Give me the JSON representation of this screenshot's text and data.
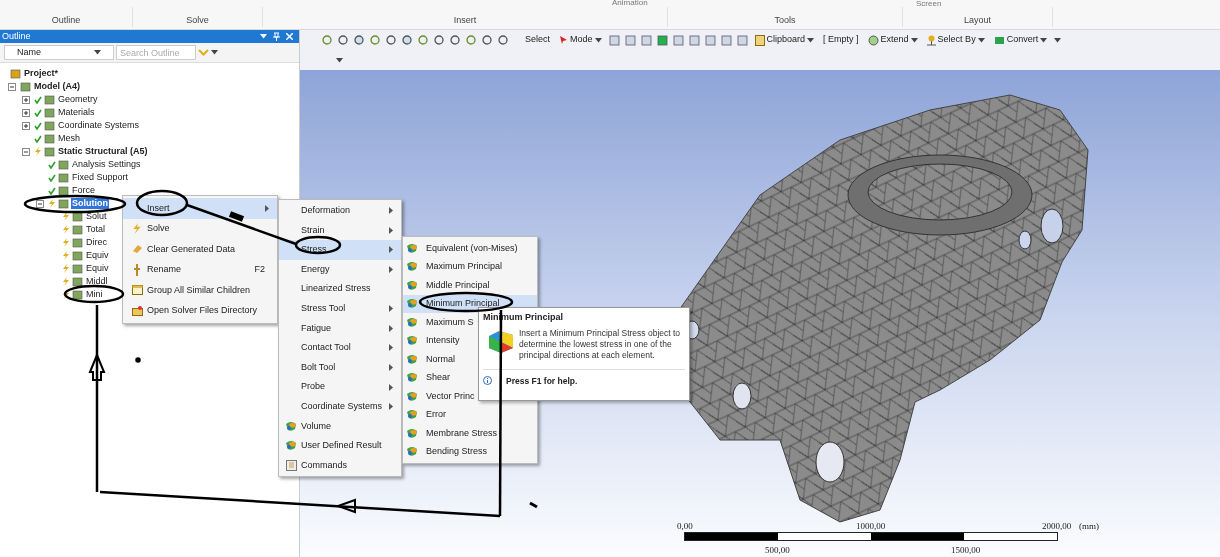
{
  "ribbon": {
    "top_labels": [
      "Animation",
      "Screen"
    ],
    "groups": [
      "Outline",
      "Solve",
      "Insert",
      "Tools",
      "Layout"
    ]
  },
  "outline": {
    "title": "Outline",
    "filter": "Name",
    "search": {
      "placeholder": "Search Outline"
    },
    "tree": [
      {
        "label": "Project*",
        "bold": true,
        "selected": false,
        "children": [
          {
            "label": "Model (A4)",
            "bold": true,
            "selected": false,
            "expanded": true,
            "children": [
              {
                "label": "Geometry",
                "bold": false,
                "selected": false,
                "solved": true,
                "expanded": false
              },
              {
                "label": "Materials",
                "bold": false,
                "selected": false,
                "solved": true,
                "expanded": false
              },
              {
                "label": "Coordinate Systems",
                "bold": false,
                "selected": false,
                "solved": true,
                "expanded": false
              },
              {
                "label": "Mesh",
                "bold": false,
                "selected": false,
                "solved": true
              },
              {
                "label": "Static Structural (A5)",
                "bold": true,
                "selected": false,
                "solved": false,
                "expanded": true,
                "children": [
                  {
                    "label": "Analysis Settings",
                    "bold": false,
                    "selected": false,
                    "solved": true
                  },
                  {
                    "label": "Fixed Support",
                    "bold": false,
                    "selected": false,
                    "solved": true
                  },
                  {
                    "label": "Force",
                    "bold": false,
                    "selected": false,
                    "solved": true
                  },
                  {
                    "label": "Solution",
                    "bold": true,
                    "selected": true,
                    "solved": false,
                    "expanded": true,
                    "children": [
                      {
                        "label": "Solut",
                        "bold": false,
                        "selected": false,
                        "solved": false
                      },
                      {
                        "label": "Total",
                        "bold": false,
                        "selected": false,
                        "solved": false
                      },
                      {
                        "label": "Direc",
                        "bold": false,
                        "selected": false,
                        "solved": false
                      },
                      {
                        "label": "Equiv",
                        "bold": false,
                        "selected": false,
                        "solved": false
                      },
                      {
                        "label": "Equiv",
                        "bold": false,
                        "selected": false,
                        "solved": false
                      },
                      {
                        "label": "Middl",
                        "bold": false,
                        "selected": false,
                        "solved": false
                      },
                      {
                        "label": "Mini",
                        "bold": false,
                        "selected": false,
                        "solved": false
                      }
                    ]
                  }
                ]
              }
            ]
          }
        ]
      }
    ]
  },
  "toolbar": {
    "buttons": [
      {
        "label": "Select",
        "dropdown": false
      },
      {
        "label": "Mode",
        "dropdown": true
      },
      {
        "label": "Clipboard",
        "dropdown": true
      },
      {
        "label": "[ Empty ]",
        "dropdown": false
      },
      {
        "label": "Extend",
        "dropdown": true
      },
      {
        "label": "Select By",
        "dropdown": true
      },
      {
        "label": "Convert",
        "dropdown": true
      }
    ]
  },
  "context_menu": [
    {
      "label": "Insert",
      "selected": true,
      "submenu": true
    },
    {
      "label": "Solve",
      "selected": false,
      "submenu": false
    },
    {
      "label": "Clear Generated Data",
      "selected": false,
      "submenu": false
    },
    {
      "label": "Rename",
      "shortcut": "F2",
      "selected": false,
      "submenu": false
    },
    {
      "label": "Group All Similar Children",
      "selected": false,
      "submenu": false
    },
    {
      "label": "Open Solver Files Directory",
      "selected": false,
      "submenu": false
    }
  ],
  "insert_menu": [
    {
      "label": "Deformation",
      "selected": false,
      "submenu": true
    },
    {
      "label": "Strain",
      "selected": false,
      "submenu": true
    },
    {
      "label": "Stress",
      "selected": true,
      "submenu": true
    },
    {
      "label": "Energy",
      "selected": false,
      "submenu": true
    },
    {
      "label": "Linearized Stress",
      "selected": false,
      "submenu": false
    },
    {
      "label": "Stress Tool",
      "selected": false,
      "submenu": true
    },
    {
      "label": "Fatigue",
      "selected": false,
      "submenu": true
    },
    {
      "label": "Contact Tool",
      "selected": false,
      "submenu": true
    },
    {
      "label": "Bolt Tool",
      "selected": false,
      "submenu": true
    },
    {
      "label": "Probe",
      "selected": false,
      "submenu": true
    },
    {
      "label": "Coordinate Systems",
      "selected": false,
      "submenu": true
    },
    {
      "label": "Volume",
      "selected": false,
      "submenu": false
    },
    {
      "label": "User Defined Result",
      "selected": false,
      "submenu": false
    },
    {
      "label": "Commands",
      "selected": false,
      "submenu": false
    }
  ],
  "stress_menu": [
    {
      "label": "Equivalent (von-Mises)",
      "selected": false
    },
    {
      "label": "Maximum Principal",
      "selected": false
    },
    {
      "label": "Middle Principal",
      "selected": false
    },
    {
      "label": "Minimum Principal",
      "selected": true
    },
    {
      "label": "Maximum S",
      "selected": false
    },
    {
      "label": "Intensity",
      "selected": false
    },
    {
      "label": "Normal",
      "selected": false
    },
    {
      "label": "Shear",
      "selected": false
    },
    {
      "label": "Vector Princ",
      "selected": false
    },
    {
      "label": "Error",
      "selected": false
    },
    {
      "label": "Membrane Stress",
      "selected": false
    },
    {
      "label": "Bending Stress",
      "selected": false
    }
  ],
  "tooltip": {
    "title": "Minimum Principal",
    "text": "Insert a Minimum Principal Stress object to determine the lowest stress in one of the principal directions at each element.",
    "help": "Press F1 for help."
  },
  "scale_bar": {
    "top_labels": [
      "0,00",
      "1000,00",
      "2000,00"
    ],
    "unit": "(mm)",
    "bottom_labels": [
      "500,00",
      "1500,00"
    ]
  }
}
